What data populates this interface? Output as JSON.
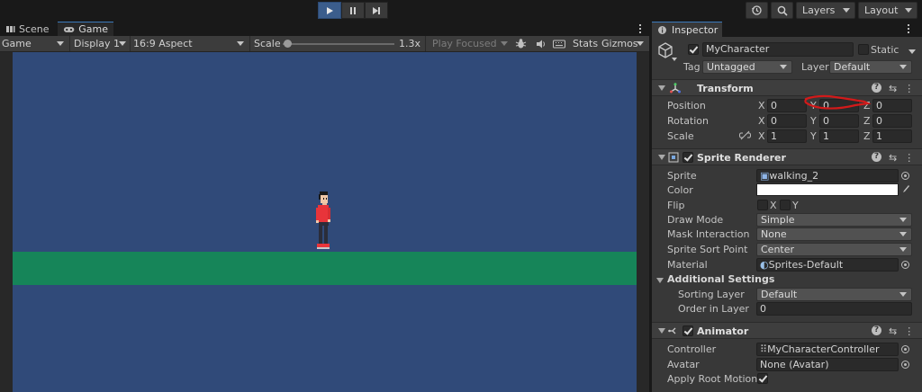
{
  "toolbar": {
    "history_icon": "history-icon",
    "search_icon": "search-icon",
    "layers_label": "Layers",
    "layout_label": "Layout"
  },
  "tabs": [
    {
      "label": "Scene",
      "icon": "scene-icon"
    },
    {
      "label": "Game",
      "icon": "gamepad-icon"
    }
  ],
  "game_bar": {
    "display_mode": "Game",
    "display": "Display 1",
    "aspect": "16:9 Aspect",
    "scale_label": "Scale",
    "scale_value": "1.3x",
    "scale_fraction": 0.02,
    "play_focused": "Play Focused",
    "stats": "Stats",
    "gizmos": "Gizmos"
  },
  "scene_colors": {
    "sky": "#304a79",
    "ground": "#168559",
    "panel_bg": "#282828",
    "annotation": "#d21a1a"
  },
  "inspector": {
    "tab_label": "Inspector",
    "object_name": "MyCharacter",
    "static_label": "Static",
    "tag_label": "Tag",
    "tag_value": "Untagged",
    "layer_label": "Layer",
    "layer_value": "Default",
    "transform": {
      "title": "Transform",
      "position_label": "Position",
      "rotation_label": "Rotation",
      "scale_label": "Scale",
      "position": {
        "x": "0",
        "y": "0",
        "z": "0"
      },
      "rotation": {
        "x": "0",
        "y": "0",
        "z": "0"
      },
      "scale": {
        "x": "1",
        "y": "1",
        "z": "1"
      }
    },
    "sprite_renderer": {
      "title": "Sprite Renderer",
      "sprite_label": "Sprite",
      "sprite_value": "walking_2",
      "color_label": "Color",
      "flip_label": "Flip",
      "flip_x": "X",
      "flip_y": "Y",
      "draw_mode_label": "Draw Mode",
      "draw_mode_value": "Simple",
      "mask_label": "Mask Interaction",
      "mask_value": "None",
      "sort_point_label": "Sprite Sort Point",
      "sort_point_value": "Center",
      "material_label": "Material",
      "material_value": "Sprites-Default",
      "additional_label": "Additional Settings",
      "sorting_layer_label": "Sorting Layer",
      "sorting_layer_value": "Default",
      "order_label": "Order in Layer",
      "order_value": "0"
    },
    "animator": {
      "title": "Animator",
      "controller_label": "Controller",
      "controller_value": "MyCharacterController",
      "avatar_label": "Avatar",
      "avatar_value": "None (Avatar)",
      "root_motion_label": "Apply Root Motion"
    }
  }
}
